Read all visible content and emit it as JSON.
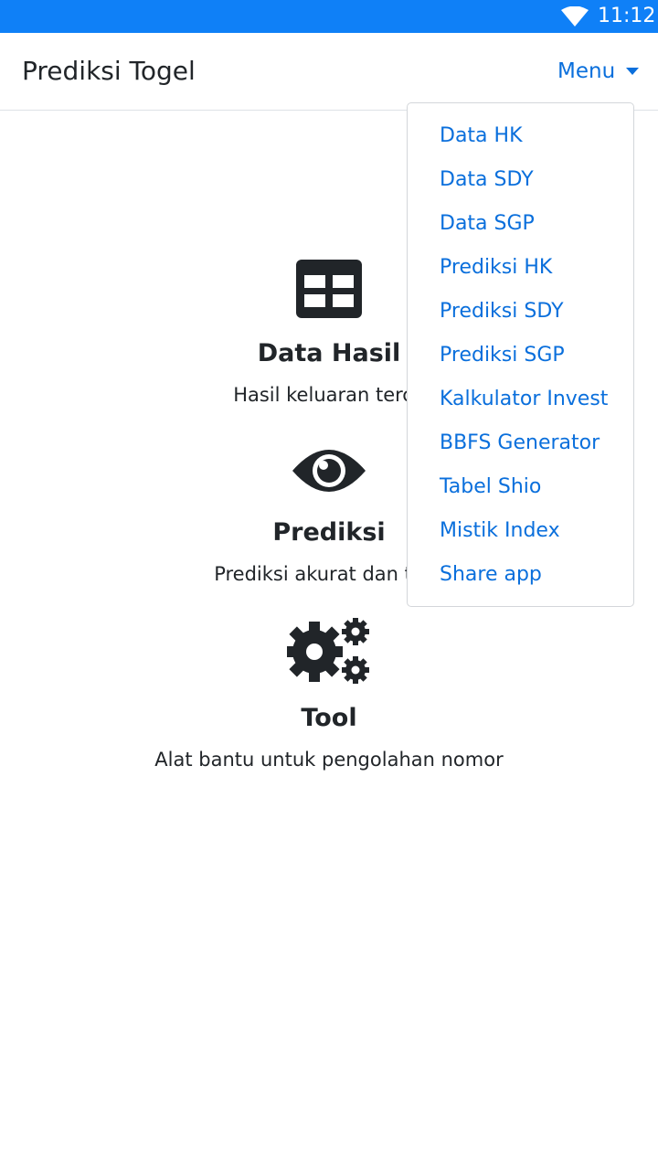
{
  "status_bar": {
    "time": "11:12",
    "wifi_icon": "wifi-icon",
    "background": "#0f80f7"
  },
  "navbar": {
    "brand": "Prediksi Togel",
    "menu_label": "Menu"
  },
  "features": [
    {
      "icon": "table-icon",
      "title": "Data Hasil",
      "description": "Hasil keluaran terce"
    },
    {
      "icon": "eye-icon",
      "title": "Prediksi",
      "description": "Prediksi akurat dan terp"
    },
    {
      "icon": "cogs-icon",
      "title": "Tool",
      "description": "Alat bantu untuk pengolahan nomor"
    }
  ],
  "dropdown": {
    "items": [
      "Data HK",
      "Data SDY",
      "Data SGP",
      "Prediksi HK",
      "Prediksi SDY",
      "Prediksi SGP",
      "Kalkulator Invest",
      "BBFS Generator",
      "Tabel Shio",
      "Mistik Index",
      "Share app"
    ]
  },
  "colors": {
    "accent": "#0a6fdc",
    "text": "#212529",
    "icon": "#212529"
  }
}
